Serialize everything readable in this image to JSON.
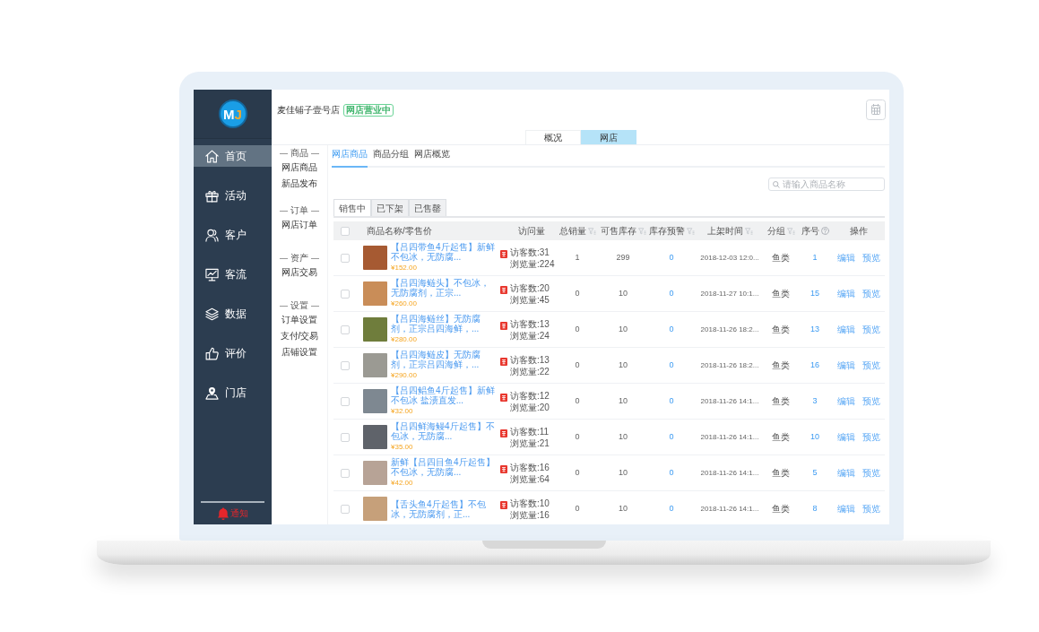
{
  "logo": {
    "letters": [
      "M",
      "J"
    ]
  },
  "sidebar": {
    "items": [
      {
        "label": "首页",
        "selected": true
      },
      {
        "label": "活动",
        "selected": false
      },
      {
        "label": "客户",
        "selected": false
      },
      {
        "label": "客流",
        "selected": false
      },
      {
        "label": "数据",
        "selected": false
      },
      {
        "label": "评价",
        "selected": false
      },
      {
        "label": "门店",
        "selected": false
      }
    ],
    "notification": "通知"
  },
  "header": {
    "store_name": "麦佳铺子壹号店",
    "store_status": "网店营业中"
  },
  "top_tabs": [
    {
      "label": "概况",
      "selected": false
    },
    {
      "label": "网店",
      "selected": true
    }
  ],
  "section_nav": [
    {
      "heading": "商品",
      "items": [
        "网店商品",
        "新品发布"
      ]
    },
    {
      "heading": "订单",
      "items": [
        "网店订单"
      ]
    },
    {
      "heading": "资产",
      "items": [
        "网店交易"
      ]
    },
    {
      "heading": "设置",
      "items": [
        "订单设置",
        "支付/交易",
        "店铺设置"
      ]
    }
  ],
  "content_tabs": [
    {
      "label": "网店商品",
      "selected": true
    },
    {
      "label": "商品分组",
      "selected": false
    },
    {
      "label": "网店概览",
      "selected": false
    }
  ],
  "search": {
    "placeholder": "请输入商品名称"
  },
  "status_tabs": [
    {
      "label": "销售中",
      "selected": true
    },
    {
      "label": "已下架",
      "selected": false
    },
    {
      "label": "已售罄",
      "selected": false
    }
  ],
  "table": {
    "select_all": {
      "checked": false
    },
    "columns": [
      {
        "kind": "checkbox"
      },
      {
        "kind": "plain",
        "label": "商品名称/零售价"
      },
      {
        "kind": "plain",
        "label": "访问量"
      },
      {
        "kind": "filter",
        "label": "总销量"
      },
      {
        "kind": "filter",
        "label": "可售库存"
      },
      {
        "kind": "filter",
        "label": "库存预警"
      },
      {
        "kind": "filter",
        "label": "上架时间"
      },
      {
        "kind": "filter",
        "label": "分组"
      },
      {
        "kind": "help",
        "label": "序号"
      },
      {
        "kind": "plain",
        "label": "操作"
      }
    ],
    "rows": [
      {
        "checked": false,
        "name": "【吕四带鱼4斤起售】新鲜不包冰，无防腐...",
        "price": "¥152.00",
        "visitors": "访客数:31",
        "views": "浏览量:224",
        "total_sales": "1",
        "stock": "299",
        "stock_alert": "0",
        "listed_at": "2018-12-03 12:0...",
        "group": "鱼类",
        "sort_order": "1",
        "actions": [
          "编辑",
          "预览"
        ]
      },
      {
        "checked": false,
        "name": "【吕四海鲢头】不包冰，无防腐剂，正宗...",
        "price": "¥260.00",
        "visitors": "访客数:20",
        "views": "浏览量:45",
        "total_sales": "0",
        "stock": "10",
        "stock_alert": "0",
        "listed_at": "2018-11-27 10:1...",
        "group": "鱼类",
        "sort_order": "15",
        "actions": [
          "编辑",
          "预览"
        ]
      },
      {
        "checked": false,
        "name": "【吕四海鲢丝】无防腐剂，正宗吕四海鲜，...",
        "price": "¥280.00",
        "visitors": "访客数:13",
        "views": "浏览量:24",
        "total_sales": "0",
        "stock": "10",
        "stock_alert": "0",
        "listed_at": "2018-11-26 18:2...",
        "group": "鱼类",
        "sort_order": "13",
        "actions": [
          "编辑",
          "预览"
        ]
      },
      {
        "checked": false,
        "name": "【吕四海鲢皮】无防腐剂，正宗吕四海鲜，...",
        "price": "¥290.00",
        "visitors": "访客数:13",
        "views": "浏览量:22",
        "total_sales": "0",
        "stock": "10",
        "stock_alert": "0",
        "listed_at": "2018-11-26 18:2...",
        "group": "鱼类",
        "sort_order": "16",
        "actions": [
          "编辑",
          "预览"
        ]
      },
      {
        "checked": false,
        "name": "【吕四鲳鱼4斤起售】新鲜不包冰 盐渍直发...",
        "price": "¥32.00",
        "visitors": "访客数:12",
        "views": "浏览量:20",
        "total_sales": "0",
        "stock": "10",
        "stock_alert": "0",
        "listed_at": "2018-11-26 14:1...",
        "group": "鱼类",
        "sort_order": "3",
        "actions": [
          "编辑",
          "预览"
        ]
      },
      {
        "checked": false,
        "name": "【吕四鲜海鳗4斤起售】不包冰，无防腐...",
        "price": "¥35.00",
        "visitors": "访客数:11",
        "views": "浏览量:21",
        "total_sales": "0",
        "stock": "10",
        "stock_alert": "0",
        "listed_at": "2018-11-26 14:1...",
        "group": "鱼类",
        "sort_order": "10",
        "actions": [
          "编辑",
          "预览"
        ]
      },
      {
        "checked": false,
        "name": "新鲜【吕四目鱼4斤起售】不包冰，无防腐...",
        "price": "¥42.00",
        "visitors": "访客数:16",
        "views": "浏览量:64",
        "total_sales": "0",
        "stock": "10",
        "stock_alert": "0",
        "listed_at": "2018-11-26 14:1...",
        "group": "鱼类",
        "sort_order": "5",
        "actions": [
          "编辑",
          "预览"
        ]
      },
      {
        "checked": false,
        "name": "【舌头鱼4斤起售】不包冰，无防腐剂，正...",
        "visitors": "访客数:10",
        "views": "浏览量:16",
        "total_sales": "0",
        "stock": "10",
        "stock_alert": "0",
        "listed_at": "2018-11-26 14:1...",
        "group": "鱼类",
        "sort_order": "8",
        "actions": [
          "编辑",
          "预览"
        ]
      }
    ]
  }
}
